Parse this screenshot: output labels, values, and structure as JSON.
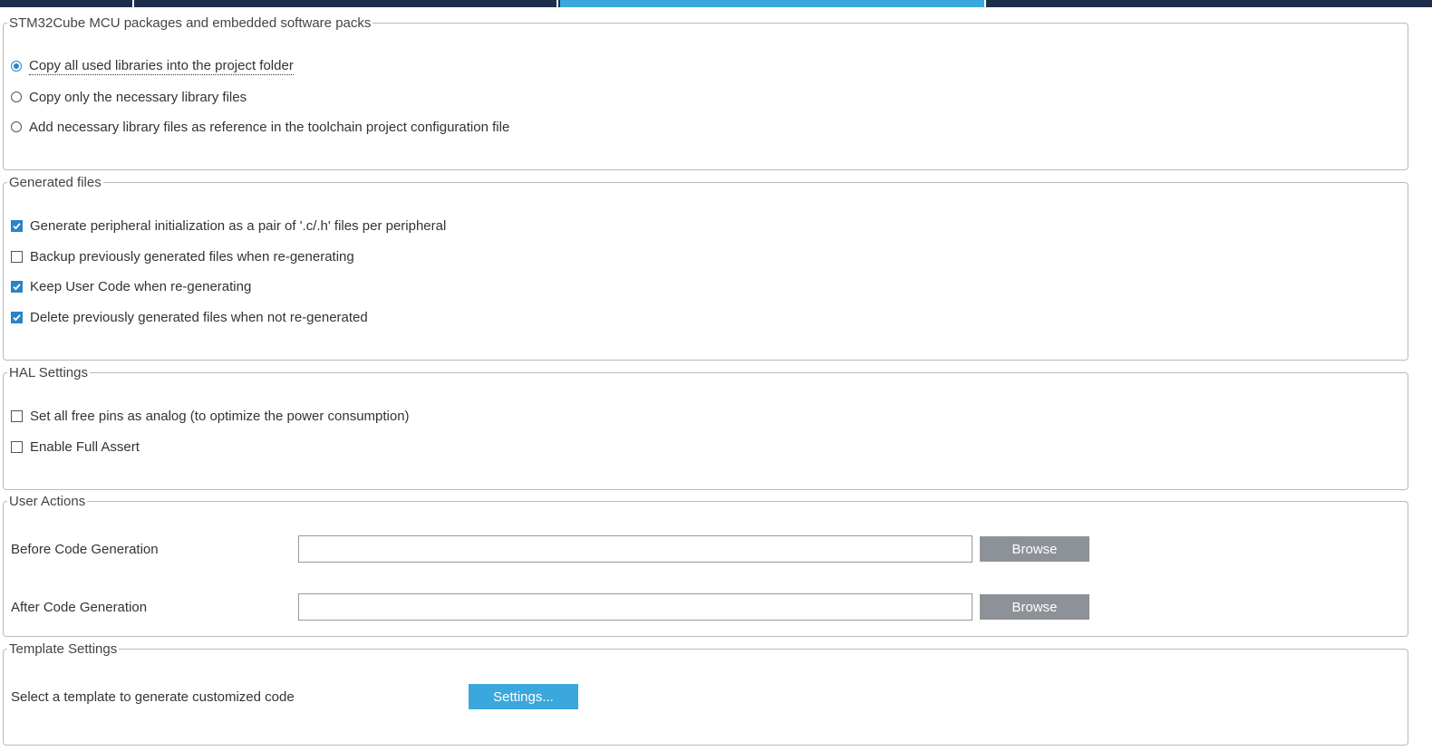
{
  "tabs": [
    {
      "label": "",
      "active": false
    },
    {
      "label": "",
      "active": false
    },
    {
      "label": "",
      "active": true
    },
    {
      "label": "",
      "active": false
    }
  ],
  "mcu_packages": {
    "legend": "STM32Cube MCU packages and embedded software packs",
    "options": [
      {
        "label": "Copy all used libraries into the project folder",
        "selected": true
      },
      {
        "label": "Copy only the necessary library files",
        "selected": false
      },
      {
        "label": "Add necessary library files as reference in the toolchain project configuration file",
        "selected": false
      }
    ]
  },
  "generated_files": {
    "legend": "Generated files",
    "options": [
      {
        "label": "Generate peripheral initialization as a pair of '.c/.h' files per peripheral",
        "checked": true
      },
      {
        "label": "Backup previously generated files when re-generating",
        "checked": false
      },
      {
        "label": "Keep User Code when re-generating",
        "checked": true
      },
      {
        "label": "Delete previously generated files when not re-generated",
        "checked": true
      }
    ]
  },
  "hal_settings": {
    "legend": "HAL Settings",
    "options": [
      {
        "label": "Set all free pins as analog (to optimize the power consumption)",
        "checked": false
      },
      {
        "label": "Enable Full Assert",
        "checked": false
      }
    ]
  },
  "user_actions": {
    "legend": "User Actions",
    "before": {
      "label": "Before Code Generation",
      "value": "",
      "browse_label": "Browse"
    },
    "after": {
      "label": "After Code Generation",
      "value": "",
      "browse_label": "Browse"
    }
  },
  "template_settings": {
    "legend": "Template Settings",
    "label": "Select a template to generate customized code",
    "button_label": "Settings..."
  },
  "colors": {
    "accent": "#2a84c6",
    "active_tab": "#3aa7dd",
    "tab_bar": "#1d2e4a",
    "browse_button": "#8d9298"
  }
}
